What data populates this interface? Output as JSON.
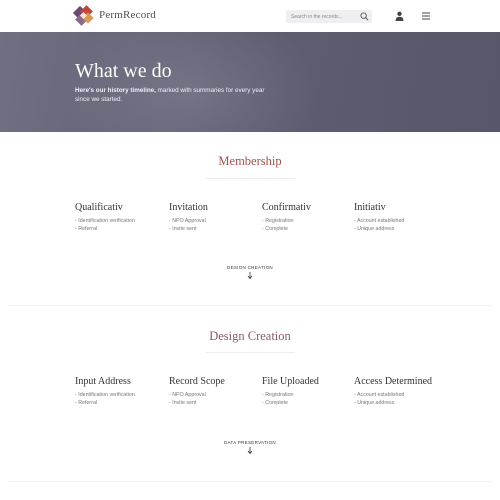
{
  "header": {
    "brand": "PermRecord",
    "search_placeholder": "Search in the records...",
    "logo_icon": "permrecord-logo",
    "icons": [
      "search-icon",
      "user-icon",
      "menu-icon"
    ]
  },
  "hero": {
    "title": "What we do",
    "subtitle_bold": "Here's our history timeline,",
    "subtitle_rest": " marked with summaries for every year since we started."
  },
  "sections": [
    {
      "title": "Membership",
      "title_color": "#a0524b",
      "columns": [
        {
          "heading": "Qualificativ",
          "items": [
            "Identification verification",
            "Referral"
          ]
        },
        {
          "heading": "Invitation",
          "items": [
            "NPO Approval",
            "Invite sent"
          ]
        },
        {
          "heading": "Confirmativ",
          "items": [
            "Registration",
            "Complete"
          ]
        },
        {
          "heading": "Initiativ",
          "items": [
            "Account established",
            "Unique address"
          ]
        }
      ],
      "next_label": "DESIGN CREATION"
    },
    {
      "title": "Design Creation",
      "title_color": "#8a5a6e",
      "columns": [
        {
          "heading": "Input Address",
          "items": [
            "Identification verification",
            "Referral"
          ]
        },
        {
          "heading": "Record Scope",
          "items": [
            "NPO Approval",
            "Invite sent"
          ]
        },
        {
          "heading": "File Uploaded",
          "items": [
            "Registration",
            "Complete"
          ]
        },
        {
          "heading": "Access Determined",
          "items": [
            "Account established",
            "Unique address"
          ]
        }
      ],
      "next_label": "DATA PRESERVATION"
    }
  ]
}
